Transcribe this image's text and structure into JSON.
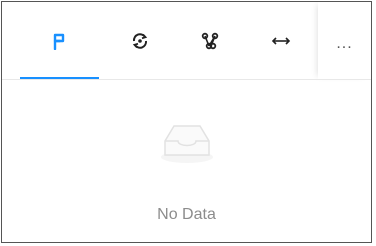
{
  "tabs": [
    {
      "icon": "flag-icon",
      "active": true
    },
    {
      "icon": "refresh-target-icon",
      "active": false
    },
    {
      "icon": "node-graph-icon",
      "active": false
    },
    {
      "icon": "horizontal-arrows-icon",
      "active": false
    }
  ],
  "more": {
    "label": "..."
  },
  "empty_state": {
    "icon": "inbox-icon",
    "text": "No Data"
  },
  "colors": {
    "accent": "#1890ff",
    "border": "#555555",
    "icon": "#222222",
    "empty_text": "#8c8c8c"
  }
}
